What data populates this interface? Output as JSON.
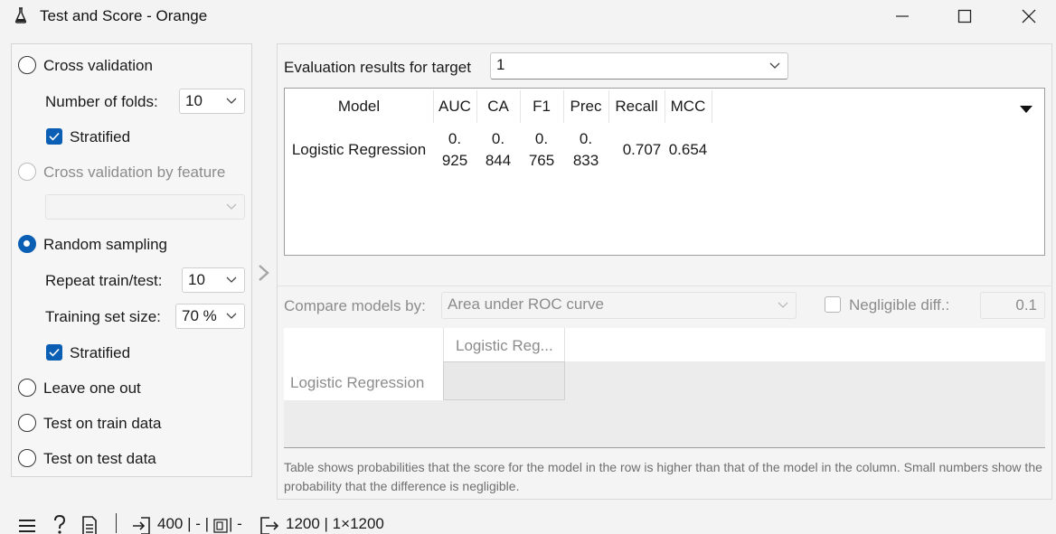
{
  "window": {
    "title": "Test and Score - Orange",
    "app_icon": "flask-icon"
  },
  "sampling": {
    "cross_validation": {
      "label": "Cross validation",
      "selected": false
    },
    "folds": {
      "label": "Number of folds:",
      "value": "10"
    },
    "stratified_cv": {
      "label": "Stratified",
      "checked": true
    },
    "cv_by_feature": {
      "label": "Cross validation by feature",
      "enabled": false,
      "value": ""
    },
    "random_sampling": {
      "label": "Random sampling",
      "selected": true
    },
    "repeat": {
      "label": "Repeat train/test:",
      "value": "10"
    },
    "train_size": {
      "label": "Training set size:",
      "value": "70 %"
    },
    "stratified_rs": {
      "label": "Stratified",
      "checked": true
    },
    "leave_one_out": {
      "label": "Leave one out",
      "selected": false
    },
    "test_on_train": {
      "label": "Test on train data",
      "selected": false
    },
    "test_on_test": {
      "label": "Test on test data",
      "selected": false
    }
  },
  "evaluation": {
    "target_label": "Evaluation results for target",
    "target_value": "1",
    "columns": [
      "Model",
      "AUC",
      "CA",
      "F1",
      "Prec",
      "Recall",
      "MCC"
    ],
    "rows": [
      {
        "model": "Logistic Regression",
        "auc": [
          "0.",
          "925"
        ],
        "ca": [
          "0.",
          "844"
        ],
        "f1": [
          "0.",
          "765"
        ],
        "prec": [
          "0.",
          "833"
        ],
        "recall": "0.707",
        "mcc": "0.654"
      }
    ]
  },
  "comparison": {
    "compare_label": "Compare models by:",
    "compare_value": "Area under ROC curve",
    "negligible_label": "Negligible diff.:",
    "negligible_checked": false,
    "negligible_value": "0.1",
    "column_header": "Logistic Reg...",
    "row_header": "Logistic Regression",
    "note": "Table shows probabilities that the score for the model in the row is higher than that of the model in the column. Small numbers show the probability that the difference is negligible."
  },
  "statusbar": {
    "input_text": "400 | - | ",
    "input_text_2": " | -",
    "output_text": "1200 | 1×1200"
  },
  "colors": {
    "accent": "#0a5fb4",
    "border": "#9d9d9d",
    "disabled_text": "#8c8c8c"
  }
}
